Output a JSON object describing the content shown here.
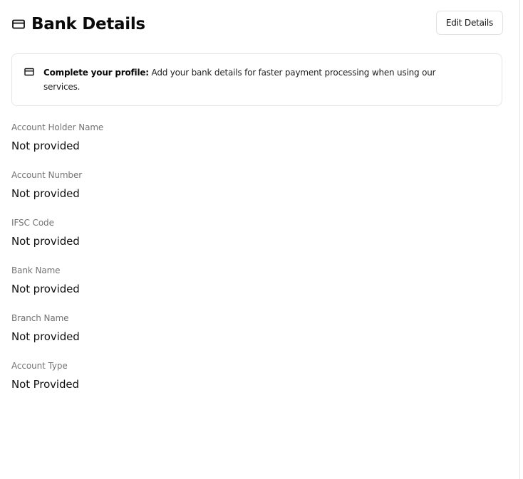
{
  "header": {
    "title": "Bank Details",
    "edit_button_label": "Edit Details",
    "title_icon": "credit-card-icon"
  },
  "alert": {
    "icon": "credit-card-icon",
    "bold_text": "Complete your profile:",
    "text": " Add your bank details for faster payment processing when using our services."
  },
  "fields": [
    {
      "label": "Account Holder Name",
      "value": "Not provided"
    },
    {
      "label": "Account Number",
      "value": "Not provided"
    },
    {
      "label": "IFSC Code",
      "value": "Not provided"
    },
    {
      "label": "Bank Name",
      "value": "Not provided"
    },
    {
      "label": "Branch Name",
      "value": "Not provided"
    },
    {
      "label": "Account Type",
      "value": "Not Provided"
    }
  ],
  "colors": {
    "label": "#737373",
    "value": "#111111",
    "border": "#e5e5e5"
  }
}
